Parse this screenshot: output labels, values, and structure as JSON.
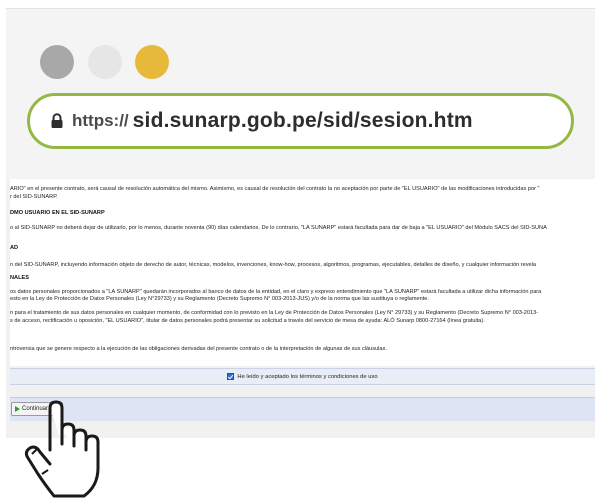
{
  "browser": {
    "dots": [
      "#a8a8a8",
      "#e6e6e6",
      "#e7b93b"
    ],
    "url_protocol": "https://",
    "url_host": "sid.sunarp.gob.pe/sid/sesion.htm",
    "accent_color": "#93b844"
  },
  "document": {
    "lines": [
      "ARIO\" en el presente contrato, será causal de resolución automática del mismo. Asimismo, es causal de resolución del contrato la no aceptación por parte de \"EL USUARIO\" de las modificaciones introducidas por \"",
      "r del SID-SUNARP.",
      "DMO USUARIO EN EL SID-SUNARP",
      "o al SID-SUNARP no deberá dejar de utilizarlo, por lo menos, durante noventa (90) días calendarios. De lo contrario, \"LA SUNARP\" estará facultada para dar de baja a \"EL USUARIO\" del Módulo SACS del SID-SUNA",
      "AD",
      "n del SID-SUNARP, incluyendo información objeto de derecho de autor, técnicas, modelos, invenciones, know-how, procesos, algoritmos, programas, ejecutables, detalles de diseño, y cualquier información revela",
      "NALES",
      "os datos personales proporcionados a \"LA SUNARP\" quedarán incorporados al banco de datos de la entidad, en el claro y expreso entendimiento que \"LA SUNARP\" estará facultada a utilizar dicha información para",
      "esto en la Ley de Protección de Datos Personales (Ley N°29733) y su Reglamento (Decreto Supremo N° 003-2013-JUS) y/o de la norma que las sustituya o reglamente.",
      "n para el tratamiento de sus datos personales en cualquier momento, de conformidad con lo previsto en la Ley de Protección de Datos Personales (Ley N° 29733) y su Reglamento (Decreto Supremo N° 003-2013-",
      "s de acceso, rectificación u oposición, \"EL USUARIO\", titular de datos personales podrá presentar su solicitud a través del servicio de mesa de ayuda: ALÓ Sunarp 0800-27164 (línea gratuita).",
      "ntroversia que se genere respecto a la ejecución de las obligaciones derivadas del presente contrato o de la interpretación de algunas de sus cláusulas."
    ]
  },
  "consent": {
    "label": "He leído y aceptado los términos y condiciones de uso",
    "checked": true
  },
  "actions": {
    "continue_label": "Continuar"
  }
}
